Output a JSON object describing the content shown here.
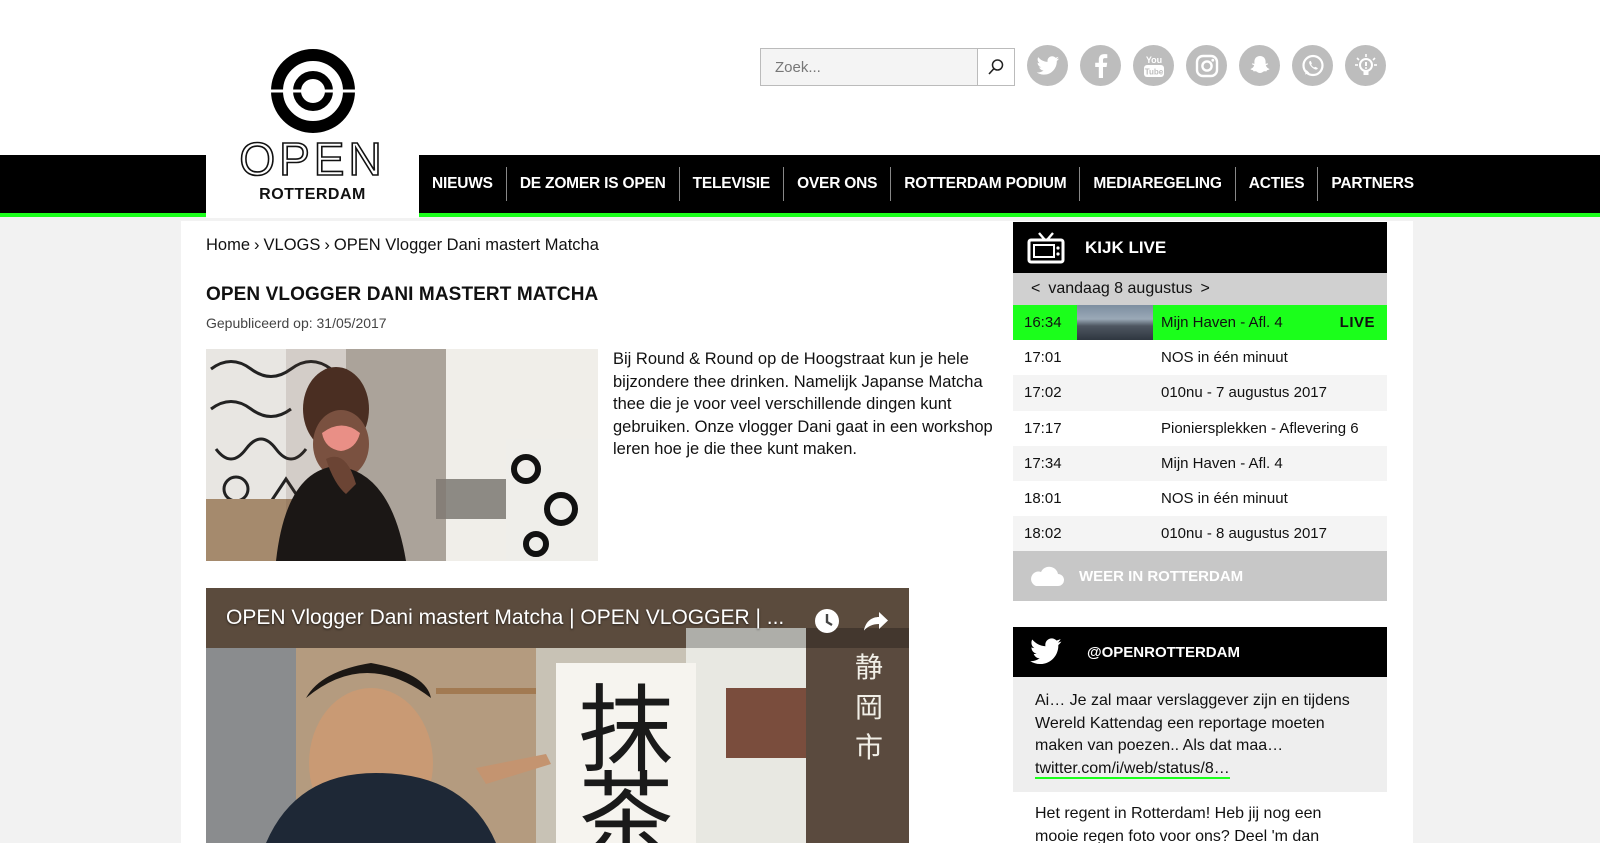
{
  "brand": {
    "word": "OPEN",
    "sub": "ROTTERDAM"
  },
  "search": {
    "placeholder": "Zoek..."
  },
  "socials": [
    "twitter-icon",
    "facebook-icon",
    "youtube-icon",
    "instagram-icon",
    "snapchat-icon",
    "whatsapp-icon",
    "lightbulb-icon"
  ],
  "nav": [
    "NIEUWS",
    "DE ZOMER IS OPEN",
    "TELEVISIE",
    "OVER ONS",
    "ROTTERDAM PODIUM",
    "MEDIAREGELING",
    "ACTIES",
    "PARTNERS"
  ],
  "breadcrumb": {
    "home": "Home",
    "sep": "›",
    "section": "VLOGS",
    "current": "OPEN Vlogger Dani mastert Matcha"
  },
  "article": {
    "title": "OPEN VLOGGER DANI MASTERT MATCHA",
    "published": "Gepubliceerd op: 31/05/2017",
    "intro": "Bij Round & Round op de Hoogstraat kun je hele bijzondere thee drinken. Namelijk Japanse Matcha thee die je voor veel verschillende dingen kunt gebruiken. Onze vlogger Dani gaat in een workshop leren hoe je die thee kunt maken.",
    "video_title": "OPEN Vlogger Dani mastert Matcha | OPEN VLOGGER | ...",
    "video_sign": "静岡市"
  },
  "live": {
    "heading": "KIJK LIVE",
    "prev": "<",
    "next": ">",
    "date": "vandaag 8 augustus",
    "live_tag": "LIVE",
    "schedule": [
      {
        "time": "16:34",
        "title": "Mijn Haven - Afl. 4"
      },
      {
        "time": "17:01",
        "title": "NOS in één minuut"
      },
      {
        "time": "17:02",
        "title": "010nu - 7 augustus 2017"
      },
      {
        "time": "17:17",
        "title": "Pioniersplekken - Aflevering 6"
      },
      {
        "time": "17:34",
        "title": "Mijn Haven - Afl. 4"
      },
      {
        "time": "18:01",
        "title": "NOS in één minuut"
      },
      {
        "time": "18:02",
        "title": "010nu - 8 augustus 2017"
      }
    ]
  },
  "weather": {
    "label": "WEER IN ROTTERDAM"
  },
  "twitter": {
    "handle": "@OPENROTTERDAM",
    "tweet1": "Ai… Je zal maar verslaggever zijn en tijdens Wereld Kattendag een reportage moeten maken van poezen.. Als dat maa…",
    "tweet1_link": "twitter.com/i/web/status/8…",
    "tweet2": "Het regent in Rotterdam! Heb jij nog een mooie regen foto voor ons? Deel 'm dan"
  },
  "colors": {
    "accent": "#1bff1b",
    "nav_bg": "#000000",
    "social_grey": "#bdbdbd"
  }
}
